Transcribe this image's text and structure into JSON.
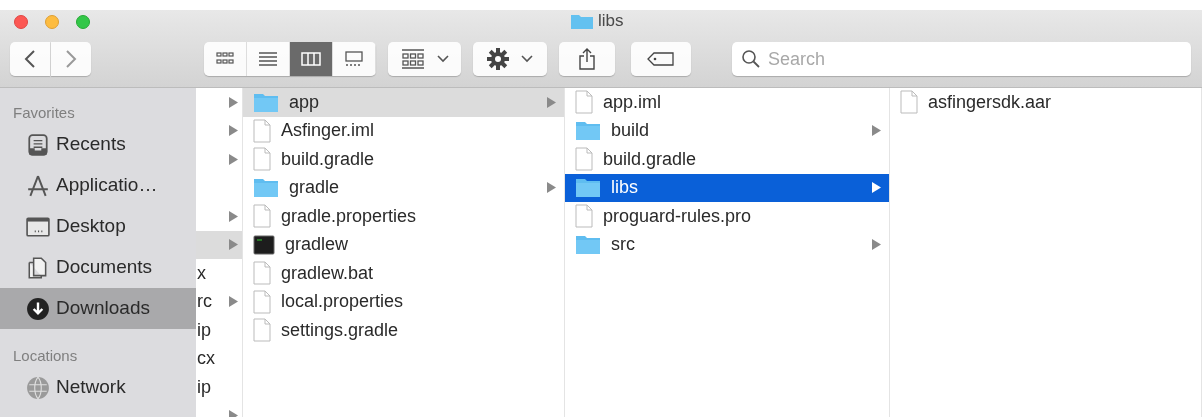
{
  "window": {
    "title": "libs"
  },
  "toolbar": {
    "view_modes": [
      {
        "kind": "icons",
        "selected": false
      },
      {
        "kind": "list",
        "selected": false
      },
      {
        "kind": "columns",
        "selected": true
      },
      {
        "kind": "gallery",
        "selected": false
      }
    ],
    "search": {
      "placeholder": "Search"
    }
  },
  "sidebar": {
    "sections": [
      {
        "heading": "Favorites",
        "items": [
          {
            "label": "Recents",
            "kind": "recents",
            "selected": false
          },
          {
            "label": "Applicatio…",
            "kind": "applications",
            "selected": false
          },
          {
            "label": "Desktop",
            "kind": "desktop",
            "selected": false
          },
          {
            "label": "Documents",
            "kind": "documents",
            "selected": false
          },
          {
            "label": "Downloads",
            "kind": "downloads",
            "selected": true
          }
        ]
      },
      {
        "heading": "Locations",
        "items": [
          {
            "label": "Network",
            "kind": "network",
            "selected": false
          }
        ]
      }
    ]
  },
  "columns": [
    {
      "rows": [
        {
          "has_children": true,
          "selected": false
        },
        {
          "has_children": true,
          "selected": false
        },
        {
          "has_children": true,
          "selected": false
        },
        {
          "has_children": false,
          "selected": false
        },
        {
          "has_children": true,
          "selected": false
        },
        {
          "has_children": true,
          "selected": true,
          "active": false
        },
        {
          "name": "x",
          "has_children": false,
          "selected": false
        },
        {
          "name": "rc",
          "has_children": true,
          "selected": false
        },
        {
          "name": "ip",
          "has_children": false,
          "selected": false
        },
        {
          "name": "cx",
          "has_children": false,
          "selected": false
        },
        {
          "name": "ip",
          "has_children": false,
          "selected": false
        },
        {
          "has_children": true,
          "selected": false
        }
      ]
    },
    {
      "rows": [
        {
          "name": "app",
          "kind": "folder",
          "has_children": true,
          "selected": true,
          "active": false
        },
        {
          "name": "Asfinger.iml",
          "kind": "file",
          "has_children": false,
          "selected": false
        },
        {
          "name": "build.gradle",
          "kind": "file",
          "has_children": false,
          "selected": false
        },
        {
          "name": "gradle",
          "kind": "folder",
          "has_children": true,
          "selected": false
        },
        {
          "name": "gradle.properties",
          "kind": "file",
          "has_children": false,
          "selected": false
        },
        {
          "name": "gradlew",
          "kind": "executable",
          "has_children": false,
          "selected": false
        },
        {
          "name": "gradlew.bat",
          "kind": "file",
          "has_children": false,
          "selected": false
        },
        {
          "name": "local.properties",
          "kind": "file",
          "has_children": false,
          "selected": false
        },
        {
          "name": "settings.gradle",
          "kind": "file",
          "has_children": false,
          "selected": false
        }
      ]
    },
    {
      "rows": [
        {
          "name": "app.iml",
          "kind": "file",
          "has_children": false,
          "selected": false
        },
        {
          "name": "build",
          "kind": "folder",
          "has_children": true,
          "selected": false
        },
        {
          "name": "build.gradle",
          "kind": "file",
          "has_children": false,
          "selected": false
        },
        {
          "name": "libs",
          "kind": "folder",
          "has_children": true,
          "selected": true,
          "active": true
        },
        {
          "name": "proguard-rules.pro",
          "kind": "file",
          "has_children": false,
          "selected": false
        },
        {
          "name": "src",
          "kind": "folder",
          "has_children": true,
          "selected": false
        }
      ]
    },
    {
      "rows": [
        {
          "name": "asfingersdk.aar",
          "kind": "file",
          "has_children": false,
          "selected": false
        }
      ]
    }
  ]
}
